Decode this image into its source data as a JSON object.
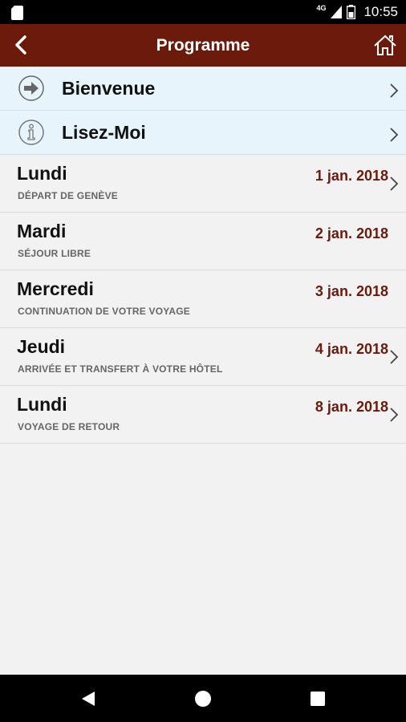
{
  "status_bar": {
    "network": "4G",
    "time": "10:55"
  },
  "app_bar": {
    "title": "Programme"
  },
  "links": [
    {
      "label": "Bienvenue",
      "icon": "arrow-right-circle-icon"
    },
    {
      "label": "Lisez-Moi",
      "icon": "info-circle-icon"
    }
  ],
  "days": [
    {
      "day": "Lundi",
      "subtitle": "DÉPART DE GENÈVE",
      "date": "1 jan. 2018",
      "chevron": true
    },
    {
      "day": "Mardi",
      "subtitle": "SÉJOUR LIBRE",
      "date": "2 jan. 2018",
      "chevron": false
    },
    {
      "day": "Mercredi",
      "subtitle": "CONTINUATION DE VOTRE VOYAGE",
      "date": "3 jan. 2018",
      "chevron": false
    },
    {
      "day": "Jeudi",
      "subtitle": "ARRIVÉE ET TRANSFERT À VOTRE HÔTEL",
      "date": "4 jan. 2018",
      "chevron": true
    },
    {
      "day": "Lundi",
      "subtitle": "VOYAGE DE RETOUR",
      "date": "8 jan. 2018",
      "chevron": true
    }
  ],
  "colors": {
    "app_bar": "#6b1a0c",
    "date_text": "#6b1a0c",
    "link_row_bg": "#e8f4fb",
    "background": "#f2f2f2"
  }
}
